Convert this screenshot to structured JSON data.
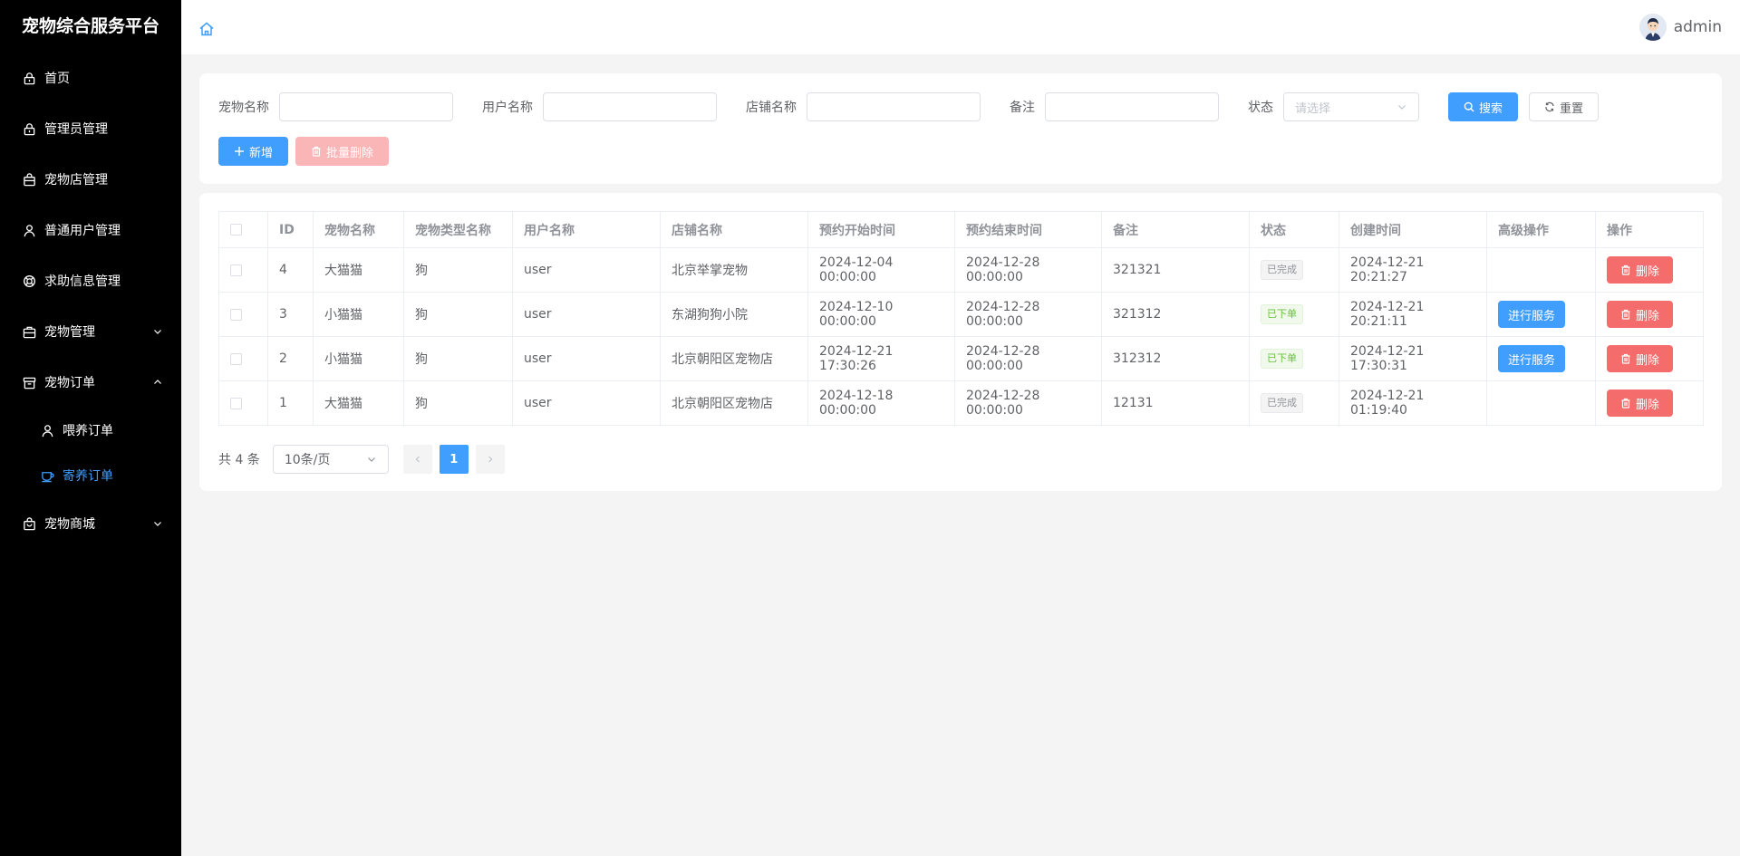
{
  "sidebar": {
    "brand": "宠物综合服务平台",
    "items": [
      {
        "label": "首页",
        "icon": "lock-icon"
      },
      {
        "label": "管理员管理",
        "icon": "lock-icon"
      },
      {
        "label": "宠物店管理",
        "icon": "shop-bag-icon"
      },
      {
        "label": "普通用户管理",
        "icon": "user-icon"
      },
      {
        "label": "求助信息管理",
        "icon": "help-buoy-icon"
      },
      {
        "label": "宠物管理",
        "icon": "suitcase-icon"
      },
      {
        "label": "宠物订单",
        "icon": "box-icon"
      },
      {
        "label": "喂养订单",
        "icon": "user-icon"
      },
      {
        "label": "寄养订单",
        "icon": "cup-icon"
      },
      {
        "label": "宠物商城",
        "icon": "shopping-bag-icon"
      }
    ]
  },
  "header": {
    "username": "admin"
  },
  "search": {
    "pet_name_label": "宠物名称",
    "user_name_label": "用户名称",
    "shop_name_label": "店铺名称",
    "remark_label": "备注",
    "status_label": "状态",
    "status_placeholder": "请选择",
    "search_button": "搜索",
    "reset_button": "重置",
    "add_button": "新增",
    "batch_delete_button": "批量删除"
  },
  "table": {
    "columns": [
      "ID",
      "宠物名称",
      "宠物类型名称",
      "用户名称",
      "店铺名称",
      "预约开始时间",
      "预约结束时间",
      "备注",
      "状态",
      "创建时间",
      "高级操作",
      "操作"
    ],
    "rows": [
      {
        "id": "4",
        "pet": "大猫猫",
        "type": "狗",
        "user": "user",
        "shop": "北京举掌宠物",
        "start": "2024-12-04 00:00:00",
        "end": "2024-12-28 00:00:00",
        "remark": "321321",
        "status": "已完成",
        "status_kind": "done",
        "created": "2024-12-21 20:21:27",
        "service": ""
      },
      {
        "id": "3",
        "pet": "小猫猫",
        "type": "狗",
        "user": "user",
        "shop": "东湖狗狗小院",
        "start": "2024-12-10 00:00:00",
        "end": "2024-12-28 00:00:00",
        "remark": "321312",
        "status": "已下单",
        "status_kind": "ordered",
        "created": "2024-12-21 20:21:11",
        "service": "进行服务"
      },
      {
        "id": "2",
        "pet": "小猫猫",
        "type": "狗",
        "user": "user",
        "shop": "北京朝阳区宠物店",
        "start": "2024-12-21 17:30:26",
        "end": "2024-12-28 00:00:00",
        "remark": "312312",
        "status": "已下单",
        "status_kind": "ordered",
        "created": "2024-12-21 17:30:31",
        "service": "进行服务"
      },
      {
        "id": "1",
        "pet": "大猫猫",
        "type": "狗",
        "user": "user",
        "shop": "北京朝阳区宠物店",
        "start": "2024-12-18 00:00:00",
        "end": "2024-12-28 00:00:00",
        "remark": "12131",
        "status": "已完成",
        "status_kind": "done",
        "created": "2024-12-21 01:19:40",
        "service": ""
      }
    ],
    "delete_label": "删除"
  },
  "pagination": {
    "total": "共 4 条",
    "page_size": "10条/页",
    "current_page": "1"
  },
  "colors": {
    "primary": "#409eff",
    "danger": "#f56c6c",
    "sidebar_bg": "#000000"
  }
}
